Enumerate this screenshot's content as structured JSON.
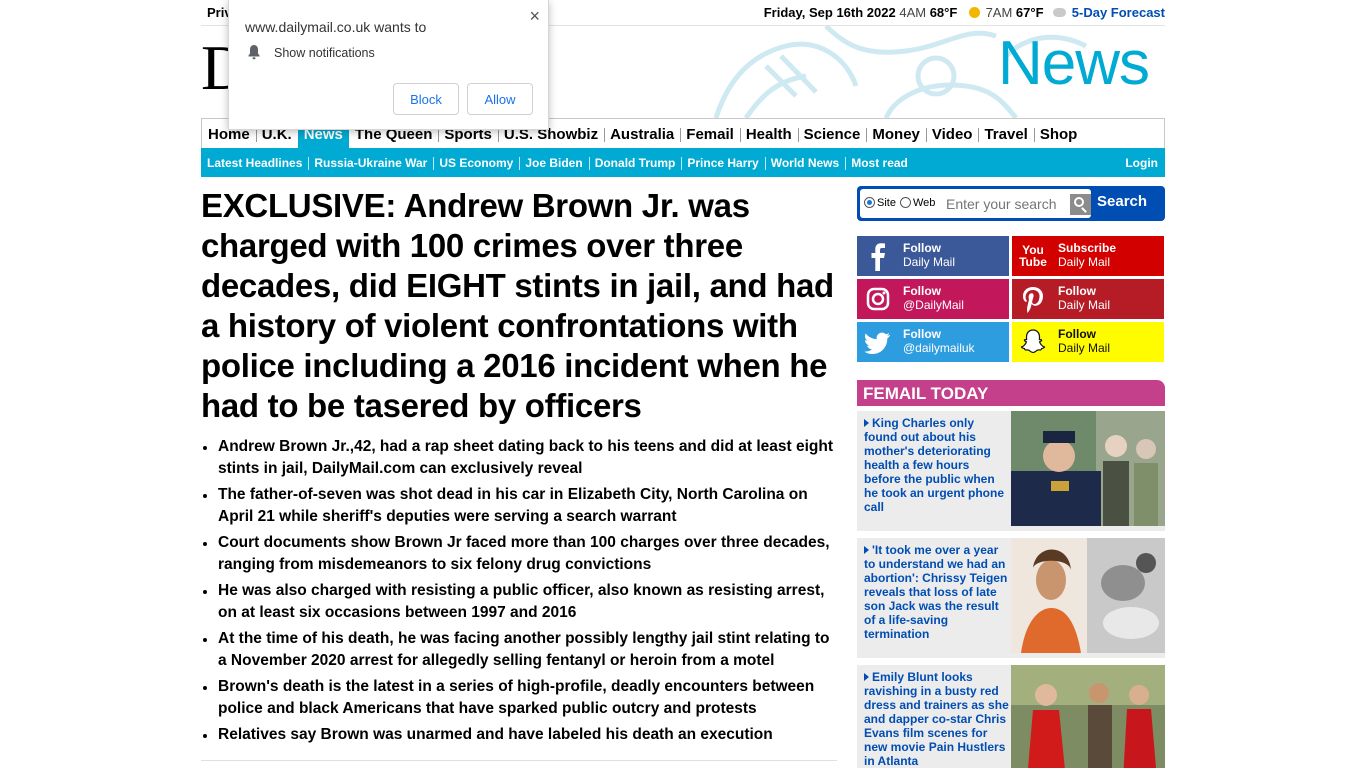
{
  "topbar": {
    "privacy_label": "Privacy Policy",
    "date": "Friday, Sep 16th 2022",
    "time1": "4AM",
    "temp1": "68°F",
    "time2": "7AM",
    "temp2": "67°F",
    "forecast_link": "5-Day Forecast"
  },
  "masthead": {
    "logo_letter": "D",
    "section_name": "News"
  },
  "nav_primary": [
    {
      "label": "Home"
    },
    {
      "label": "U.K."
    },
    {
      "label": "News",
      "active": true
    },
    {
      "label": "The Queen"
    },
    {
      "label": "Sports"
    },
    {
      "label": "U.S. Showbiz"
    },
    {
      "label": "Australia"
    },
    {
      "label": "Femail"
    },
    {
      "label": "Health"
    },
    {
      "label": "Science"
    },
    {
      "label": "Money"
    },
    {
      "label": "Video"
    },
    {
      "label": "Travel"
    },
    {
      "label": "Shop"
    }
  ],
  "nav_secondary": {
    "items": [
      {
        "label": "Latest Headlines"
      },
      {
        "label": "Russia-Ukraine War"
      },
      {
        "label": "US Economy"
      },
      {
        "label": "Joe Biden"
      },
      {
        "label": "Donald Trump"
      },
      {
        "label": "Prince Harry"
      },
      {
        "label": "World News"
      },
      {
        "label": "Most read"
      }
    ],
    "login": "Login"
  },
  "article": {
    "headline": "EXCLUSIVE: Andrew Brown Jr. was charged with 100 crimes over three decades, did EIGHT stints in jail, and had a history of violent confrontations with police including a 2016 incident when he had to be tasered by officers",
    "bullets": [
      "Andrew Brown Jr.,42, had a rap sheet dating back to his teens and did at least eight stints in jail, DailyMail.com can exclusively reveal",
      "The father-of-seven was shot dead in his car in Elizabeth City, North Carolina on April 21 while sheriff's deputies were serving a search warrant",
      "Court documents show Brown Jr faced more than 100 charges over three decades, ranging from misdemeanors to six felony drug convictions",
      "He was also charged with resisting a public officer, also known as resisting arrest, on at least six occasions between 1997 and 2016",
      "At the time of his death, he was facing another possibly lengthy jail stint relating to a November 2020 arrest for allegedly selling fentanyl or heroin from a motel",
      "Brown's death is the latest in a series of high-profile, deadly encounters between police and black Americans that have sparked public outcry and protests",
      "Relatives say Brown was unarmed and have labeled his death an execution"
    ]
  },
  "search": {
    "site_label": "Site",
    "web_label": "Web",
    "placeholder": "Enter your search",
    "button": "Search"
  },
  "social": {
    "facebook": {
      "line1": "Follow",
      "line2": "Daily Mail"
    },
    "youtube": {
      "line1": "Subscribe",
      "line2": "Daily Mail",
      "icon_text_top": "You",
      "icon_text_bottom": "Tube"
    },
    "instagram": {
      "line1": "Follow",
      "line2": "@DailyMail"
    },
    "pinterest": {
      "line1": "Follow",
      "line2": "Daily Mail"
    },
    "twitter": {
      "line1": "Follow",
      "line2": "@dailymailuk"
    },
    "snapchat": {
      "line1": "Follow",
      "line2": "Daily Mail"
    }
  },
  "femail": {
    "heading": "FEMAIL TODAY",
    "stories": [
      {
        "text": "King Charles only found out about his mother's deteriorating health a few hours before the public when he took an urgent phone call"
      },
      {
        "text": "'It took me over a year to understand we had an abortion': Chrissy Teigen reveals that loss of late son Jack was the result of a life-saving termination"
      },
      {
        "text": "Emily Blunt looks ravishing in a busty red dress and trainers as she and dapper co-star Chris Evans film scenes for new movie Pain Hustlers in Atlanta"
      }
    ]
  },
  "popup": {
    "origin": "www.dailymail.co.uk wants to",
    "permission": "Show notifications",
    "block": "Block",
    "allow": "Allow",
    "close": "×"
  },
  "colors": {
    "brand_blue": "#00aad2",
    "link_blue": "#004db3",
    "femail_pink": "#c5408a"
  }
}
